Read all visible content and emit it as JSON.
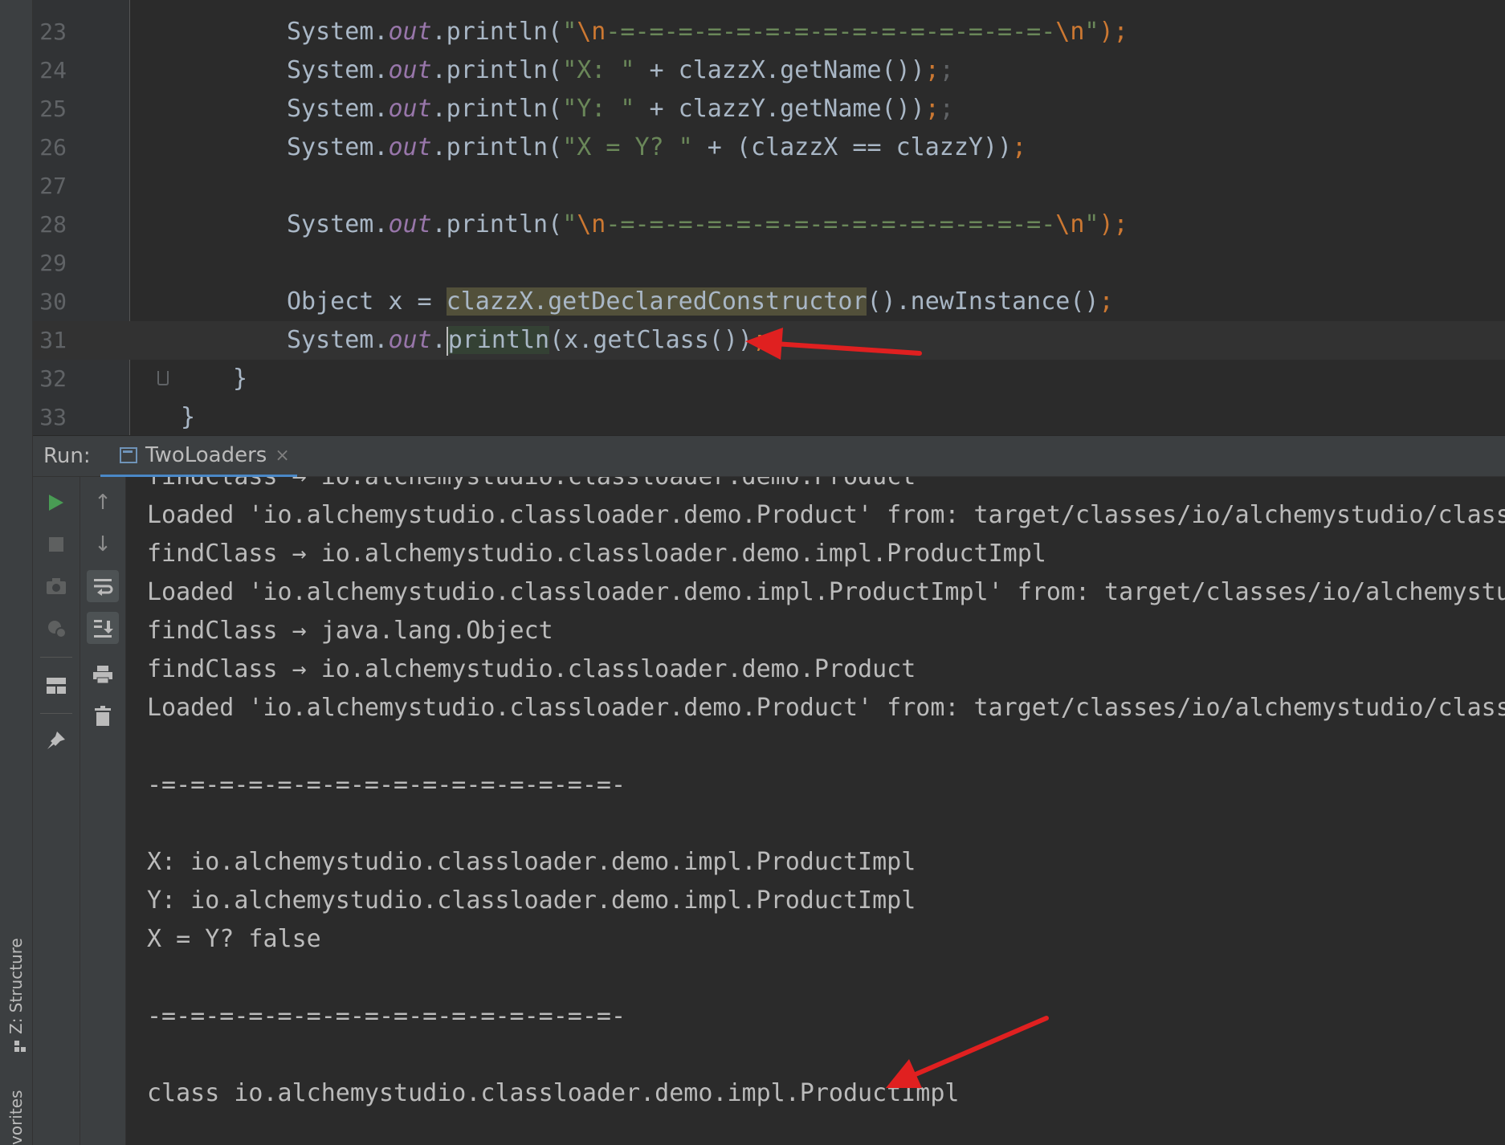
{
  "editor": {
    "lines": [
      {
        "num": "23",
        "parts": [
          {
            "t": "System.",
            "c": ""
          },
          {
            "t": "out",
            "c": "fld"
          },
          {
            "t": ".println(",
            "c": ""
          },
          {
            "t": "\"",
            "c": "str"
          },
          {
            "t": "\\n",
            "c": "esc"
          },
          {
            "t": "-=-=-=-=-=-=-=-=-=-=-=-=-=-=-=-",
            "c": "str"
          },
          {
            "t": "\\n",
            "c": "esc"
          },
          {
            "t": "\"",
            "c": "str"
          },
          {
            "t": ");",
            "c": "kw"
          }
        ]
      },
      {
        "num": "24",
        "parts": [
          {
            "t": "System.",
            "c": ""
          },
          {
            "t": "out",
            "c": "fld"
          },
          {
            "t": ".println(",
            "c": ""
          },
          {
            "t": "\"X: \"",
            "c": "str"
          },
          {
            "t": " + clazzX.getName())",
            "c": ""
          },
          {
            "t": ";",
            "c": "kw"
          },
          {
            "t": ";",
            "c": "dim"
          }
        ]
      },
      {
        "num": "25",
        "parts": [
          {
            "t": "System.",
            "c": ""
          },
          {
            "t": "out",
            "c": "fld"
          },
          {
            "t": ".println(",
            "c": ""
          },
          {
            "t": "\"Y: \"",
            "c": "str"
          },
          {
            "t": " + clazzY.getName())",
            "c": ""
          },
          {
            "t": ";",
            "c": "kw"
          },
          {
            "t": ";",
            "c": "dim"
          }
        ]
      },
      {
        "num": "26",
        "parts": [
          {
            "t": "System.",
            "c": ""
          },
          {
            "t": "out",
            "c": "fld"
          },
          {
            "t": ".println(",
            "c": ""
          },
          {
            "t": "\"X = Y? \"",
            "c": "str"
          },
          {
            "t": " + (clazzX == clazzY))",
            "c": ""
          },
          {
            "t": ";",
            "c": "kw"
          }
        ]
      },
      {
        "num": "27",
        "parts": []
      },
      {
        "num": "28",
        "parts": [
          {
            "t": "System.",
            "c": ""
          },
          {
            "t": "out",
            "c": "fld"
          },
          {
            "t": ".println(",
            "c": ""
          },
          {
            "t": "\"",
            "c": "str"
          },
          {
            "t": "\\n",
            "c": "esc"
          },
          {
            "t": "-=-=-=-=-=-=-=-=-=-=-=-=-=-=-=-",
            "c": "str"
          },
          {
            "t": "\\n",
            "c": "esc"
          },
          {
            "t": "\"",
            "c": "str"
          },
          {
            "t": ");",
            "c": "kw"
          }
        ]
      },
      {
        "num": "29",
        "parts": []
      },
      {
        "num": "30",
        "parts": [
          {
            "t": "Object x = ",
            "c": ""
          },
          {
            "t": "clazzX.getDeclaredConstructor",
            "c": "hl-usage"
          },
          {
            "t": "().newInstance()",
            "c": ""
          },
          {
            "t": ";",
            "c": "kw"
          }
        ]
      },
      {
        "num": "31",
        "parts": [
          {
            "t": "System.",
            "c": ""
          },
          {
            "t": "out",
            "c": "fld"
          },
          {
            "t": ".",
            "c": ""
          },
          {
            "t": "|",
            "c": "caret"
          },
          {
            "t": "println",
            "c": "hl-caret"
          },
          {
            "t": "(x.getClass())",
            "c": ""
          },
          {
            "t": ";",
            "c": "kw"
          }
        ]
      },
      {
        "num": "32",
        "parts": [
          {
            "t": "}",
            "c": ""
          }
        ]
      },
      {
        "num": "33",
        "parts": [
          {
            "t": "}",
            "c": ""
          }
        ]
      }
    ]
  },
  "run_panel": {
    "label": "Run:",
    "tab_name": "TwoLoaders",
    "tab_close": "×"
  },
  "console": {
    "lines": [
      "findClass → io.alchemystudio.classloader.demo.Product",
      "Loaded 'io.alchemystudio.classloader.demo.Product' from: target/classes/io/alchemystudio/class",
      "findClass → io.alchemystudio.classloader.demo.impl.ProductImpl",
      "Loaded 'io.alchemystudio.classloader.demo.impl.ProductImpl' from: target/classes/io/alchemystu",
      "findClass → java.lang.Object",
      "findClass → io.alchemystudio.classloader.demo.Product",
      "Loaded 'io.alchemystudio.classloader.demo.Product' from: target/classes/io/alchemystudio/class",
      "",
      "-=-=-=-=-=-=-=-=-=-=-=-=-=-=-=-=-",
      "",
      "X: io.alchemystudio.classloader.demo.impl.ProductImpl",
      "Y: io.alchemystudio.classloader.demo.impl.ProductImpl",
      "X = Y? false",
      "",
      "-=-=-=-=-=-=-=-=-=-=-=-=-=-=-=-=-",
      "",
      "class io.alchemystudio.classloader.demo.impl.ProductImpl"
    ]
  },
  "left_strip": {
    "structure_tab": "Z: Structure",
    "favorites_tab": "vorites"
  },
  "toolbar_icons": {
    "rerun": "▶",
    "stop": "■",
    "up": "↑",
    "down": "↓",
    "print": "⎙",
    "trash": "🗑"
  },
  "colors": {
    "accent_green": "#499c54",
    "arrow_red": "#e02020",
    "tab_underline": "#4a88c7"
  }
}
